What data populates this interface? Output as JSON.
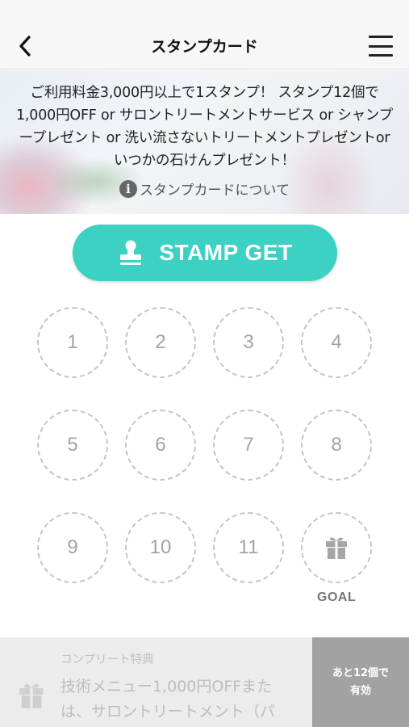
{
  "header": {
    "title": "スタンプカード"
  },
  "banner": {
    "description": "ご利用料金3,000円以上で1スタンプ！ スタンプ12個で1,000円OFF or サロントリートメントサービス or シャンプープレゼント or 洗い流さないトリートメントプレゼントorいつかの石けんプレゼント！",
    "about_link": "スタンプカードについて"
  },
  "stamp_button": {
    "label": "STAMP GET"
  },
  "stamp_slots": [
    "1",
    "2",
    "3",
    "4",
    "5",
    "6",
    "7",
    "8",
    "9",
    "10",
    "11"
  ],
  "goal": {
    "label": "GOAL"
  },
  "complete": {
    "heading": "コンプリート特典",
    "body": "技術メニュー1,000円OFFまたは、サロントリートメント（パ",
    "remaining_line1": "あと12個で",
    "remaining_line2": "有効"
  },
  "colors": {
    "accent": "#3cd1c3",
    "slot_border": "#c4c4c4",
    "remaining_bg": "#a2a2a2"
  },
  "icons": {
    "back": "chevron-left-icon",
    "menu": "hamburger-icon",
    "info": "info-icon",
    "stamp": "stamp-icon",
    "gift": "gift-icon"
  }
}
